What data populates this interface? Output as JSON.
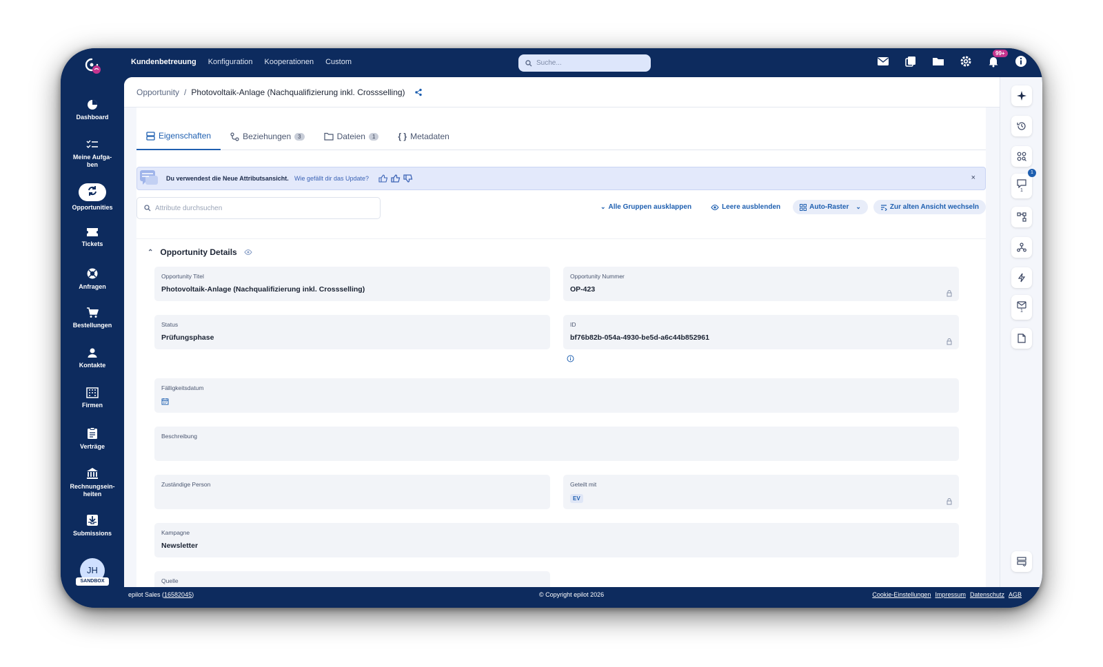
{
  "topnav": {
    "items": [
      "Kundenbetreuung",
      "Konfiguration",
      "Kooperationen",
      "Custom"
    ],
    "active": "Kundenbetreuung"
  },
  "search": {
    "placeholder": "Suche..."
  },
  "notifications": {
    "badge": "99+"
  },
  "sidebar": {
    "items": [
      {
        "label": "Dashboard",
        "icon": "pie-chart-icon"
      },
      {
        "label": "Meine Aufga-\nben",
        "icon": "tasks-icon"
      },
      {
        "label": "Opportunities",
        "icon": "refresh-icon"
      },
      {
        "label": "Tickets",
        "icon": "ticket-icon"
      },
      {
        "label": "Anfragen",
        "icon": "lifebuoy-icon"
      },
      {
        "label": "Bestellungen",
        "icon": "cart-icon"
      },
      {
        "label": "Kontakte",
        "icon": "person-icon"
      },
      {
        "label": "Firmen",
        "icon": "building-icon"
      },
      {
        "label": "Verträge",
        "icon": "clipboard-icon"
      },
      {
        "label": "Rechnungsein-\nheiten",
        "icon": "bank-icon"
      },
      {
        "label": "Submissions",
        "icon": "inbox-icon"
      }
    ],
    "avatar_initials": "JH",
    "sandbox_label": "SANDBOX"
  },
  "breadcrumb": {
    "parent": "Opportunity",
    "separator": "/",
    "current": "Photovoltaik-Anlage (Nachqualifizierung inkl. Crossselling)"
  },
  "tabs": [
    {
      "label": "Eigenschaften",
      "count": null,
      "active": true
    },
    {
      "label": "Beziehungen",
      "count": "3",
      "active": false
    },
    {
      "label": "Dateien",
      "count": "1",
      "active": false
    },
    {
      "label": "Metadaten",
      "count": null,
      "active": false
    }
  ],
  "banner": {
    "message": "Du verwendest die Neue Attributsansicht.",
    "question": "Wie gefällt dir das Update?",
    "close": "×"
  },
  "attr_search": {
    "placeholder": "Attribute durchsuchen"
  },
  "toolbar": {
    "expand_all": "Alle Gruppen ausklappen",
    "hide_empty": "Leere ausblenden",
    "auto_grid": "Auto-Raster",
    "old_view": "Zur alten Ansicht wechseln"
  },
  "group": {
    "title": "Opportunity Details",
    "fields": {
      "titel": {
        "label": "Opportunity Titel",
        "value": "Photovoltaik-Anlage (Nachqualifizierung inkl. Crossselling)"
      },
      "nummer": {
        "label": "Opportunity Nummer",
        "value": "OP-423"
      },
      "status": {
        "label": "Status",
        "value": "Prüfungsphase"
      },
      "id": {
        "label": "ID",
        "value": "bf76b82b-054a-4930-be5d-a6c44b852961"
      },
      "faellig": {
        "label": "Fälligkeitsdatum",
        "value": ""
      },
      "beschreibung": {
        "label": "Beschreibung",
        "value": ""
      },
      "person": {
        "label": "Zuständige Person",
        "value": ""
      },
      "geteilt": {
        "label": "Geteilt mit",
        "value": "EV"
      },
      "kampagne": {
        "label": "Kampagne",
        "value": "Newsletter"
      },
      "quelle": {
        "label": "Quelle",
        "value": ""
      }
    }
  },
  "rightrail": {
    "badge": "1",
    "counts": {
      "comments": "1",
      "mail": "1"
    }
  },
  "footer": {
    "left_prefix": "epilot Sales (",
    "left_id": "16582045",
    "left_suffix": ")",
    "copyright": "© Copyright epilot 2026",
    "links": [
      "Cookie-Einstellungen",
      "Impressum",
      "Datenschutz",
      "AGB"
    ]
  },
  "colors": {
    "navy": "#0d2b5e",
    "accent": "#1e5fb0",
    "badge_pink": "#c4348e"
  }
}
